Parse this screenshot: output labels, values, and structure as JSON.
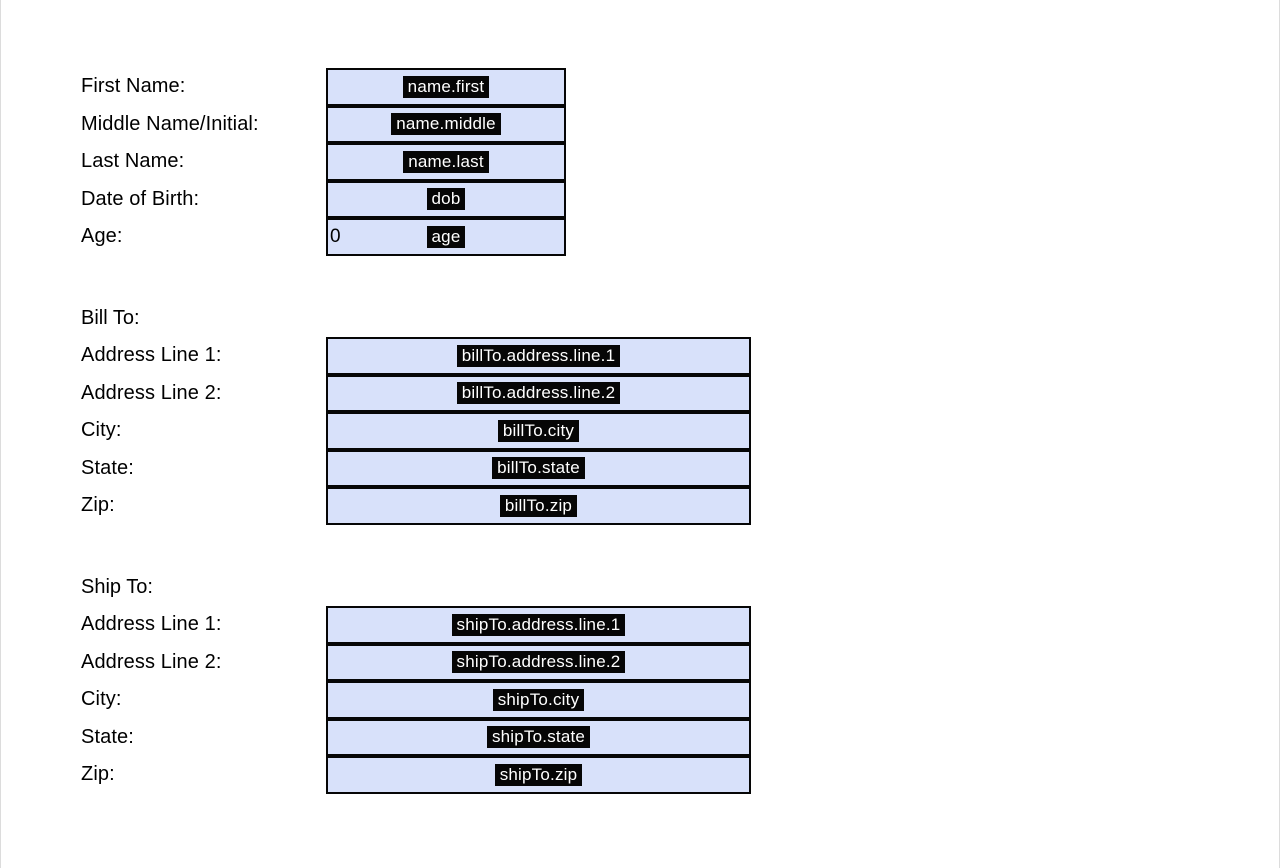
{
  "person": {
    "labels": {
      "first": "First Name:",
      "middle": "Middle Name/Initial:",
      "last": "Last Name:",
      "dob": "Date of Birth:",
      "age": "Age:"
    },
    "bindings": {
      "first": "name.first",
      "middle": "name.middle",
      "last": "name.last",
      "dob": "dob",
      "age": "age"
    },
    "agePrefix": "0"
  },
  "billTo": {
    "title": "Bill To:",
    "labels": {
      "line1": "Address Line 1:",
      "line2": "Address Line 2:",
      "city": "City:",
      "state": "State:",
      "zip": "Zip:"
    },
    "bindings": {
      "line1": "billTo.address.line.1",
      "line2": "billTo.address.line.2",
      "city": "billTo.city",
      "state": "billTo.state",
      "zip": "billTo.zip"
    }
  },
  "shipTo": {
    "title": "Ship To:",
    "labels": {
      "line1": "Address Line 1:",
      "line2": "Address Line 2:",
      "city": "City:",
      "state": "State:",
      "zip": "Zip:"
    },
    "bindings": {
      "line1": "shipTo.address.line.1",
      "line2": "shipTo.address.line.2",
      "city": "shipTo.city",
      "state": "shipTo.state",
      "zip": "shipTo.zip"
    }
  }
}
